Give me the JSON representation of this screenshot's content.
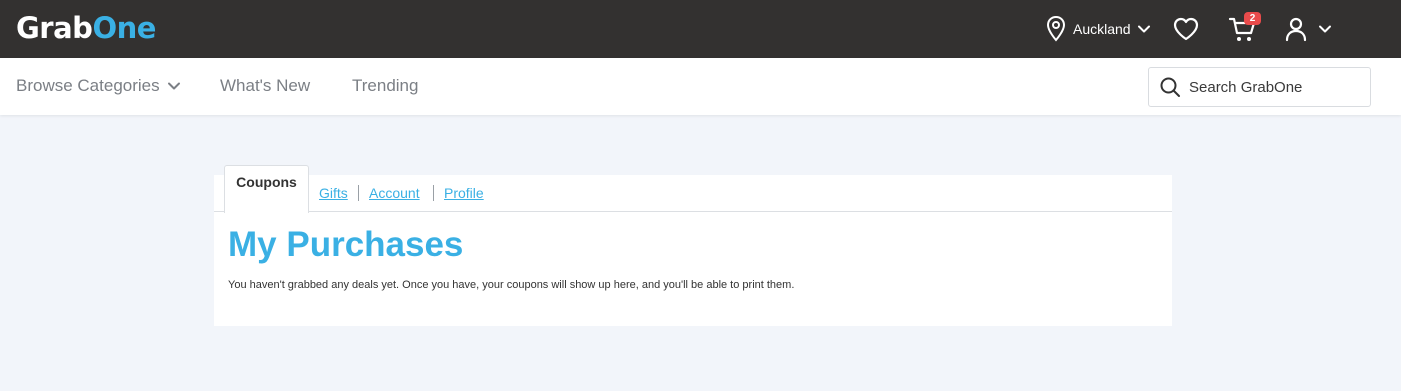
{
  "header": {
    "logo_part1": "Grab",
    "logo_part2": "One",
    "location": "Auckland",
    "cart_count": "2"
  },
  "nav": {
    "browse_categories": "Browse Categories",
    "whats_new": "What's New",
    "trending": "Trending",
    "search_placeholder": "Search GrabOne"
  },
  "tabs": {
    "coupons": "Coupons",
    "gifts": "Gifts",
    "account": "Account",
    "profile": "Profile"
  },
  "main": {
    "title": "My Purchases",
    "message": "You haven't grabbed any deals yet. Once you have, your coupons will show up here, and you'll be able to print them."
  },
  "colors": {
    "topbar_bg": "#333130",
    "accent": "#3ab0e4",
    "badge": "#e94b4b",
    "page_bg": "#f2f5fa"
  }
}
